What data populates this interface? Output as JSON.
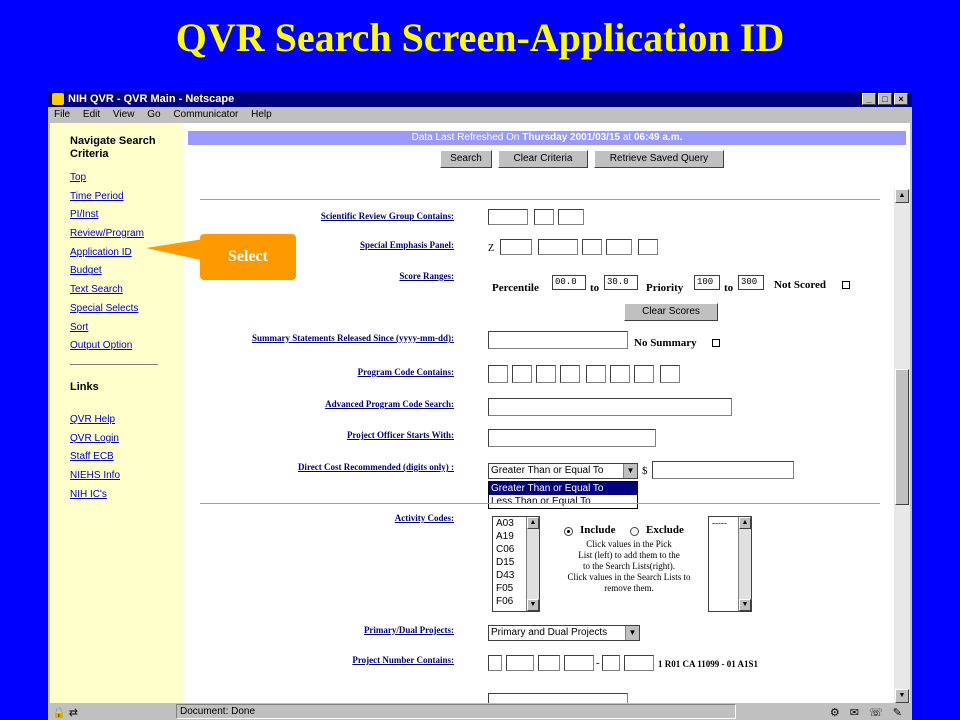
{
  "slide": {
    "title": "QVR Search Screen-Application ID"
  },
  "window": {
    "title": "NIH QVR - QVR Main - Netscape",
    "controls": [
      "_",
      "□",
      "×"
    ],
    "menu": [
      "File",
      "Edit",
      "View",
      "Go",
      "Communicator",
      "Help"
    ]
  },
  "sidebar": {
    "heading": "Navigate Search Criteria",
    "nav": [
      "Top",
      "Time Period",
      "PI/Inst",
      "Review/Program",
      "Application ID",
      "Budget",
      "Text Search",
      "Special Selects",
      "Sort",
      "Output Option"
    ],
    "links_heading": "Links",
    "links": [
      "QVR Help ",
      "QVR Login",
      "Staff ECB",
      "NIEHS Info",
      "NIH IC's"
    ]
  },
  "header": {
    "refresh_prefix": "Data Last Refreshed On ",
    "refresh_date": "Thursday 2001/03/15",
    "refresh_mid": " at ",
    "refresh_time": "06:49 a.m.",
    "search_btn": "Search",
    "clear_btn": "Clear Criteria",
    "retrieve_btn": "Retrieve Saved Query"
  },
  "form": {
    "srg_label": "Scientific Review Group Contains:",
    "sep_label": "Special Emphasis Panel:",
    "sep_prefix": "Z",
    "score_label": "Score Ranges:",
    "percentile_label": "Percentile",
    "percentile_from": "00.0",
    "percentile_to_label": "to",
    "percentile_to": "30.0",
    "priority_label": "Priority",
    "priority_from": "100",
    "priority_to_label": "to",
    "priority_to": "300",
    "not_scored_label": "Not Scored",
    "clear_scores_btn": "Clear Scores",
    "summary_label": "Summary Statements Released Since (yyyy-mm-dd):",
    "no_summary_label": "No Summary",
    "program_code_label": "Program Code Contains:",
    "adv_program_label": "Advanced Program Code Search:",
    "po_label": "Project Officer Starts With:",
    "direct_cost_label": "Direct Cost Recommended (digits only) :",
    "direct_cost_selected": "Greater Than or Equal To",
    "direct_cost_options": [
      "Greater Than or Equal To",
      "Less Than or Equal To"
    ],
    "dollar": "$",
    "activity_label": "Activity Codes:",
    "activity_codes": [
      "A03",
      "A19",
      "C06",
      "D15",
      "D43",
      "F05",
      "F06"
    ],
    "include_label": "Include",
    "exclude_label": "Exclude",
    "pick_help": [
      "Click values in the Pick",
      "List (left) to add them to the",
      "to the Search Lists(right).",
      "Click values in the Search Lists to",
      "remove them."
    ],
    "search_list_placeholder": "-----",
    "primary_label": "Primary/Dual Projects:",
    "primary_selected": "Primary and Dual Projects",
    "project_number_label": "Project Number Contains:",
    "project_number_dash": "-",
    "project_number_example": "1 R01 CA 11099 - 01 A1S1"
  },
  "status": {
    "text": "Document: Done"
  },
  "callout": {
    "label": "Select"
  }
}
